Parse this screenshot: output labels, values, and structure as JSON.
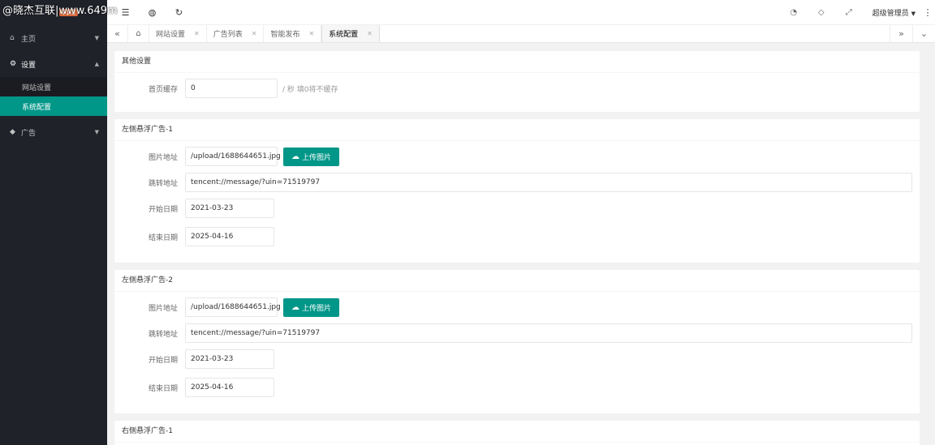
{
  "watermark": "@晓杰互联|www.649m",
  "sidebar": {
    "logo_version": "v1.2",
    "items": [
      {
        "label": "主页"
      },
      {
        "label": "设置"
      },
      {
        "label": "广告"
      }
    ],
    "sub_items": [
      {
        "label": "网站设置"
      },
      {
        "label": "系统配置"
      }
    ]
  },
  "header": {
    "user": "超级管理员"
  },
  "tabs": [
    {
      "label": "网站设置"
    },
    {
      "label": "广告列表"
    },
    {
      "label": "智能发布"
    },
    {
      "label": "系统配置"
    }
  ],
  "sections": {
    "other": {
      "title": "其他设置",
      "cache_label": "首页缓存",
      "cache_value": "0",
      "cache_hint": "/ 秒 填0将不缓存"
    },
    "left1": {
      "title": "左侧悬浮广告-1",
      "image_label": "图片地址",
      "image_value": "/upload/1688644651.jpg",
      "upload_label": "上传图片",
      "link_label": "跳转地址",
      "link_value": "tencent://message/?uin=71519797",
      "start_label": "开始日期",
      "start_value": "2021-03-23",
      "end_label": "结束日期",
      "end_value": "2025-04-16"
    },
    "left2": {
      "title": "左侧悬浮广告-2",
      "image_label": "图片地址",
      "image_value": "/upload/1688644651.jpg",
      "upload_label": "上传图片",
      "link_label": "跳转地址",
      "link_value": "tencent://message/?uin=71519797",
      "start_label": "开始日期",
      "start_value": "2021-03-23",
      "end_label": "结束日期",
      "end_value": "2025-04-16"
    },
    "right1": {
      "title": "右侧悬浮广告-1"
    }
  }
}
